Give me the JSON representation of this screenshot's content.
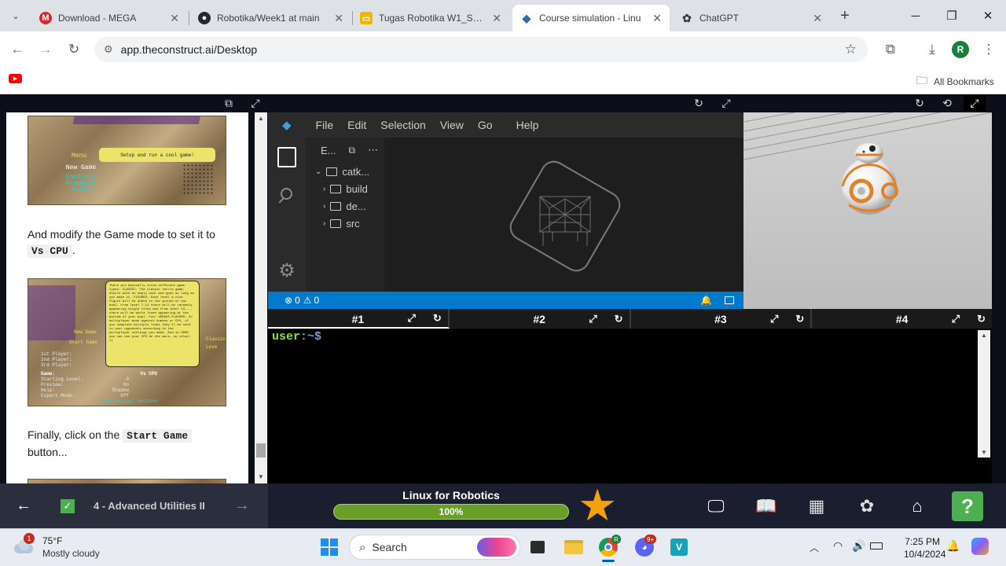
{
  "browser": {
    "tabs": [
      {
        "title": "Download - MEGA",
        "icon": "mega-icon"
      },
      {
        "title": "Robotika/Week1 at main",
        "icon": "github-icon"
      },
      {
        "title": "Tugas Robotika W1_Sem",
        "icon": "slides-icon"
      },
      {
        "title": "Course simulation - Linu",
        "icon": "construct-icon",
        "active": true
      },
      {
        "title": "ChatGPT",
        "icon": "chatgpt-icon"
      }
    ],
    "url": "app.theconstruct.ai/Desktop",
    "bookmarks_label": "All Bookmarks",
    "profile_initial": "R"
  },
  "notebook": {
    "img1_menu": "Menu",
    "img1_bubble": "Setup and run a cool game!",
    "img1_items": [
      "New Game",
      "Controls",
      "Graphics",
      "Audio"
    ],
    "text1_a": "And modify the Game mode to set it to",
    "text1_code": "Vs CPU",
    "text1_end": ".",
    "img2_rows": [
      {
        "label": "1st Player:",
        "value": ""
      },
      {
        "label": "2nd Player:",
        "value": ""
      },
      {
        "label": "3rd Player:",
        "value": ""
      },
      {
        "label": "Game:",
        "value": "Vs CPU"
      },
      {
        "label": "Starting Level:",
        "value": "0"
      },
      {
        "label": "Preview:",
        "value": "On"
      },
      {
        "label": "Help:",
        "value": "Shadow"
      },
      {
        "label": "Expert Mode:",
        "value": "Off"
      }
    ],
    "img2_footer": "Multiplayer Options",
    "img2_menu": [
      "New Game",
      "Start Game"
    ],
    "img2_side": "Classic Leve",
    "img2_bubble": "There are basically three different game types: CLASSIC: The classic tetris game. Starts with an empty bowl and goes as long as you make it. FIGURES: Each level a nice figure will be added in the ground of you bowl. From level 7-12 there will be randomly appearing single tiles and from level 13-... there will be whole lines appearing at the bottom of your bowl. Fun! VERSUS PLAYERS: In multiplayer mode against humans or CPU, if you complete multiple lines they'll be send to your opponents according to the multiplayer settings you made. And in DEMO you can see your CPU do the work, so relax! =)",
    "text2_a": "Finally, click on the",
    "text2_code": "Start Game",
    "text2_b": "button..."
  },
  "vscode": {
    "menu": [
      "File",
      "Edit",
      "Selection",
      "View",
      "Go",
      "Help"
    ],
    "explorer_title": "E...",
    "tree": [
      "catk...",
      "build",
      "de...",
      "src"
    ],
    "errors": "0",
    "warnings": "0"
  },
  "terminal": {
    "tabs": [
      "#1",
      "#2",
      "#3",
      "#4"
    ],
    "prompt_user": "user",
    "prompt_rest": ":~$"
  },
  "bottom": {
    "unit": "4 - Advanced Utilities II",
    "course": "Linux for Robotics",
    "progress_text": "100%",
    "progress_value": 100
  },
  "taskbar": {
    "weather_temp": "75°F",
    "weather_desc": "Mostly cloudy",
    "weather_badge": "1",
    "search": "Search",
    "time": "7:25 PM",
    "date": "10/4/2024",
    "discord_badge": "9+"
  }
}
